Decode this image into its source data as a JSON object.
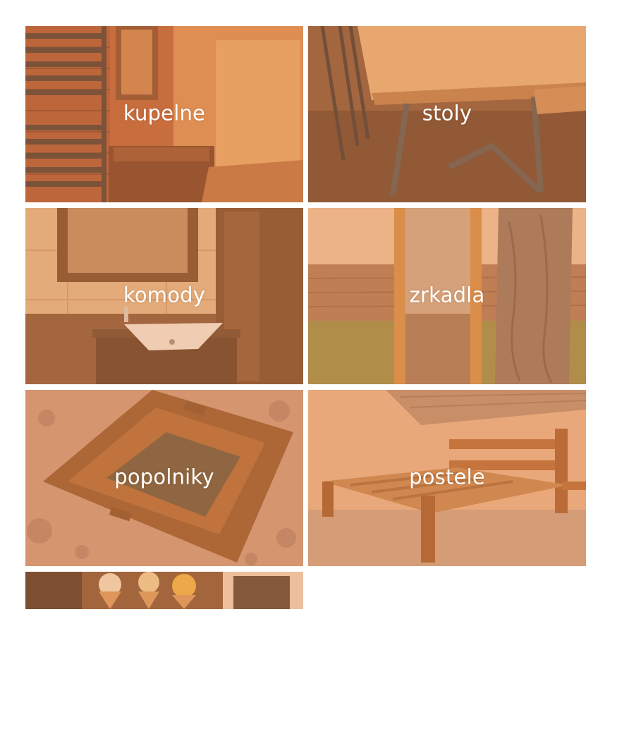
{
  "categories": [
    {
      "label": "kupelne",
      "art": "bathroom-photo"
    },
    {
      "label": "stoly",
      "art": "table-photo"
    },
    {
      "label": "komody",
      "art": "sink-cabinet-photo"
    },
    {
      "label": "zrkadla",
      "art": "mirror-field-photo"
    },
    {
      "label": "popolniky",
      "art": "ashtray-photo"
    },
    {
      "label": "postele",
      "art": "bed-photo"
    },
    {
      "label": "",
      "art": "ice-cream-photo"
    }
  ],
  "colors": {
    "overlay_tint": "#e8965f",
    "label_text": "#ffffff",
    "background": "#ffffff"
  }
}
